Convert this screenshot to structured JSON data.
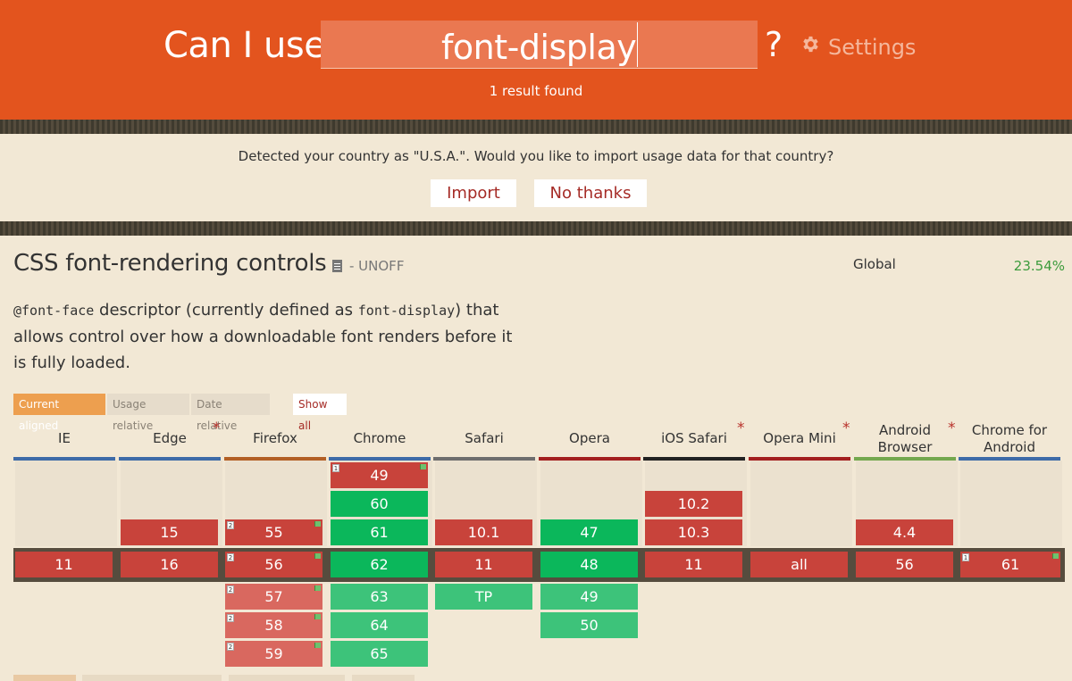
{
  "header": {
    "brand": "Can I use",
    "search_value": "font-display",
    "help": "?",
    "settings_label": "Settings",
    "results": "1 result found"
  },
  "notice": {
    "text": "Detected your country as \"U.S.A.\". Would you like to import usage data for that country?",
    "import_label": "Import",
    "dismiss_label": "No thanks"
  },
  "feature": {
    "title": "CSS font-rendering controls",
    "status": "- UNOFF",
    "global_label": "Global",
    "global_value": "23.54%",
    "desc_code1": "@font-face",
    "desc_text1": " descriptor (currently defined as ",
    "desc_code2": "font-display",
    "desc_text2": ") that allows control over how a downloadable font renders before it is fully loaded."
  },
  "views": {
    "current": "Current aligned",
    "usage": "Usage relative",
    "date": "Date relative",
    "show_all": "Show all"
  },
  "browsers": [
    {
      "name": "IE",
      "color": "#3e6ba8",
      "star": false
    },
    {
      "name": "Edge",
      "color": "#3e6ba8",
      "star": true
    },
    {
      "name": "Firefox",
      "color": "#b35f25",
      "star": false
    },
    {
      "name": "Chrome",
      "color": "#3e6ba8",
      "star": false
    },
    {
      "name": "Safari",
      "color": "#6e6e6e",
      "star": false
    },
    {
      "name": "Opera",
      "color": "#a31f1f",
      "star": false
    },
    {
      "name": "iOS Safari",
      "color": "#222222",
      "star": true
    },
    {
      "name": "Opera Mini",
      "color": "#a31f1f",
      "star": true
    },
    {
      "name": "Android Browser",
      "line1": "Android",
      "line2": "Browser",
      "color": "#74a84e",
      "star": true
    },
    {
      "name": "Chrome for Android",
      "line1": "Chrome for",
      "line2": "Android",
      "color": "#3e6ba8",
      "star": false
    }
  ],
  "versions": {
    "chrome_past": [
      "49",
      "60",
      "61"
    ],
    "edge_past": [
      "15"
    ],
    "firefox_past": [
      "55"
    ],
    "safari_past": [
      "10.1"
    ],
    "opera_past": [
      "47"
    ],
    "ios_past": [
      "10.2",
      "10.3"
    ],
    "android_past": [
      "4.4"
    ],
    "current": [
      "11",
      "16",
      "56",
      "62",
      "11",
      "48",
      "11",
      "all",
      "56",
      "61"
    ],
    "firefox_future": [
      "57",
      "58",
      "59"
    ],
    "chrome_future": [
      "63",
      "64",
      "65"
    ],
    "safari_future": [
      "TP"
    ],
    "opera_future": [
      "49",
      "50"
    ]
  },
  "notes": {
    "one": "1",
    "two": "2"
  },
  "colors": {
    "header": "#e3541e",
    "supported": "#0bb75b",
    "unsupported": "#c8433b",
    "supported_future": "#3dc37a",
    "unsupported_future": "#d9685f"
  }
}
